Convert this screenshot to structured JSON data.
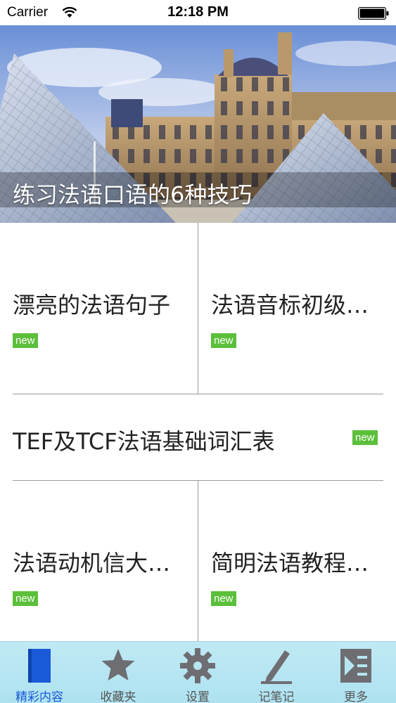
{
  "status_bar": {
    "carrier": "Carrier",
    "time": "12:18 PM"
  },
  "hero": {
    "title": "练习法语口语的6种技巧",
    "image_alt": "Louvre pyramid"
  },
  "articles": [
    {
      "title": "漂亮的法语句子",
      "badge": "new"
    },
    {
      "title": "法语音标初级…",
      "badge": "new"
    },
    {
      "title": "TEF及TCF法语基础词汇表",
      "badge": "new"
    },
    {
      "title": "法语动机信大…",
      "badge": "new"
    },
    {
      "title": "简明法语教程…",
      "badge": "new"
    }
  ],
  "tab_bar": {
    "tabs": [
      {
        "label": "精彩内容",
        "icon": "book-icon",
        "active": true
      },
      {
        "label": "收藏夹",
        "icon": "star-icon",
        "active": false
      },
      {
        "label": "设置",
        "icon": "gear-icon",
        "active": false
      },
      {
        "label": "记笔记",
        "icon": "pencil-icon",
        "active": false
      },
      {
        "label": "更多",
        "icon": "more-icon",
        "active": false
      }
    ]
  },
  "colors": {
    "badge": "#5bbf3a",
    "tab_active": "#1a5ad8",
    "tab_bar_bg": "#bfe9f4"
  }
}
